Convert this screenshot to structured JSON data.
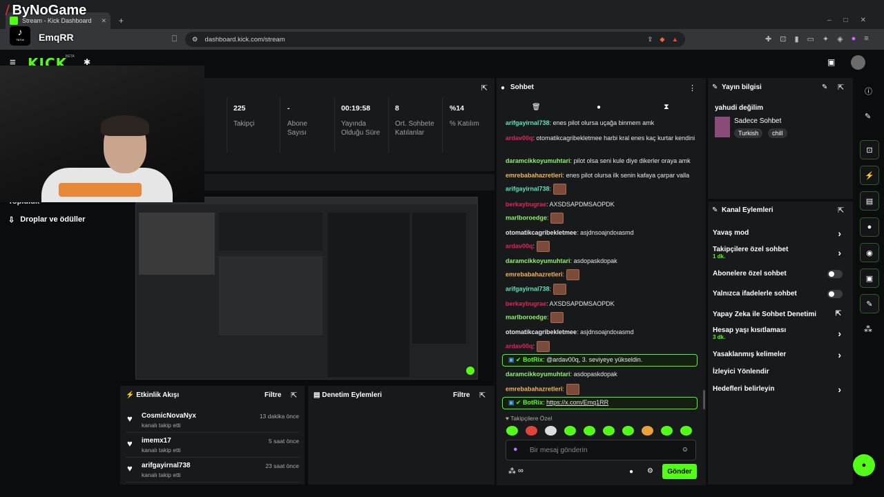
{
  "watermark": {
    "brand": "ByNoGame",
    "platform": "TikTok",
    "handle": "EmqRR"
  },
  "browser": {
    "tab_title": "Stream - Kick Dashboard",
    "url": "dashboard.kick.com/stream"
  },
  "kick": {
    "logo": "KICK",
    "beta": "BETA"
  },
  "sidebar": {
    "partial_item": "Topluluk",
    "drops_label": "Droplar ve ödüller"
  },
  "stats": [
    {
      "value": "225",
      "label": "Takipçi"
    },
    {
      "value": "-",
      "label": "Abone Sayısı"
    },
    {
      "value": "00:19:58",
      "label": "Yayında Olduğu Süre"
    },
    {
      "value": "8",
      "label": "Ort. Sohbete Katılanlar"
    },
    {
      "value": "%14",
      "label": "% Katılım"
    }
  ],
  "chat": {
    "title": "Sohbet",
    "messages": [
      {
        "user": "arifgayirnal738",
        "color": "#5fe3c0",
        "text": "enes pilot olursa uçağa binmem amk",
        "emote": false
      },
      {
        "user": "ardav00q",
        "color": "#e0245e",
        "text": "otomatikcagribekletmee harbi kral enes kaç kurtar kendini",
        "emote": false
      },
      {
        "user": "daramcikkoyumuhtari",
        "color": "#8cf26a",
        "text": "pilot olsa seni kule diye dikerler oraya amk",
        "emote": false
      },
      {
        "user": "emrebabahazretleri",
        "color": "#f0b45a",
        "text": "enes pilot olursa ilk senin kafaya çarpar valla",
        "emote": false
      },
      {
        "user": "arifgayirnal738",
        "color": "#5fe3c0",
        "text": "",
        "emote": true
      },
      {
        "user": "berkaybugrae",
        "color": "#e0245e",
        "text": "AXSDSAPDMSAOPDK",
        "emote": false
      },
      {
        "user": "marlboroedge",
        "color": "#8cf26a",
        "text": "",
        "emote": true
      },
      {
        "user": "otomatikcagribekletmee",
        "color": "#e8e8e8",
        "text": "asjdnsoajndoıasmd",
        "emote": false
      },
      {
        "user": "ardav00q",
        "color": "#e0245e",
        "text": "",
        "emote": true
      },
      {
        "user": "daramcikkoyumuhtari",
        "color": "#8cf26a",
        "text": "asdopaskdopak",
        "emote": false
      },
      {
        "user": "emrebabahazretleri",
        "color": "#f0b45a",
        "text": "",
        "emote": true
      },
      {
        "user": "arifgayirnal738",
        "color": "#5fe3c0",
        "text": "",
        "emote": true
      },
      {
        "user": "berkaybugrae",
        "color": "#e0245e",
        "text": "AXSDSAPDMSAOPDK",
        "emote": false
      },
      {
        "user": "marlboroedge",
        "color": "#8cf26a",
        "text": "",
        "emote": true
      },
      {
        "user": "otomatikcagribekletmee",
        "color": "#e8e8e8",
        "text": "asjdnsoajndoıasmd",
        "emote": false
      },
      {
        "user": "ardav00q",
        "color": "#e0245e",
        "text": "",
        "emote": true
      }
    ],
    "bot1": {
      "user": "BotRix",
      "text": "@ardav00q, 3. seviyeye yükseldin."
    },
    "after_bot": [
      {
        "user": "daramcikkoyumuhtari",
        "color": "#8cf26a",
        "text": "asdopaskdopak",
        "emote": false
      },
      {
        "user": "emrebabahazretleri",
        "color": "#f0b45a",
        "text": "",
        "emote": true
      }
    ],
    "bot2": {
      "user": "BotRix",
      "text": "https://x.com/Emq1RR"
    },
    "emote_section": "Takipçilere Özel",
    "input_placeholder": "Bir mesaj gönderin",
    "send_label": "Gönder",
    "infinity": "∞"
  },
  "stream_info": {
    "title": "Yayın bilgisi",
    "stream_title": "yahudi değilim",
    "category": "Sadece Sohbet",
    "tags": [
      "Turkish",
      "chill"
    ]
  },
  "channel_actions": {
    "title": "Kanal Eylemleri",
    "items": [
      {
        "label": "Yavaş mod",
        "sub": "",
        "control": "chevron"
      },
      {
        "label": "Takipçilere özel sohbet",
        "sub": "1 dk.",
        "control": "chevron"
      },
      {
        "label": "Abonelere özel sohbet",
        "sub": "",
        "control": "toggle"
      },
      {
        "label": "Yalnızca ifadelerle sohbet",
        "sub": "",
        "control": "toggle"
      },
      {
        "label": "Yapay Zeka ile Sohbet Denetimi",
        "sub": "",
        "control": "external"
      },
      {
        "label": "Hesap yaşı kısıtlaması",
        "sub": "3 dk.",
        "control": "chevron"
      },
      {
        "label": "Yasaklanmış kelimeler",
        "sub": "",
        "control": "chevron"
      },
      {
        "label": "İzleyici Yönlendir",
        "sub": "",
        "control": "none"
      },
      {
        "label": "Hedefleri belirleyin",
        "sub": "",
        "control": "chevron"
      }
    ]
  },
  "activity": {
    "title": "Etkinlik Akışı",
    "filter": "Filtre",
    "items": [
      {
        "user": "CosmicNovaNyx",
        "action": "kanalı takip etti",
        "time": "13 dakika önce"
      },
      {
        "user": "imemx17",
        "action": "kanalı takip etti",
        "time": "5 saat önce"
      },
      {
        "user": "arifgayirnal738",
        "action": "kanalı takip etti",
        "time": "23 saat önce"
      }
    ]
  },
  "moderation": {
    "title": "Denetim Eylemleri",
    "filter": "Filtre"
  },
  "colors": {
    "accent": "#53fc18",
    "bg": "#0b0c0d",
    "panel": "#18191b"
  }
}
